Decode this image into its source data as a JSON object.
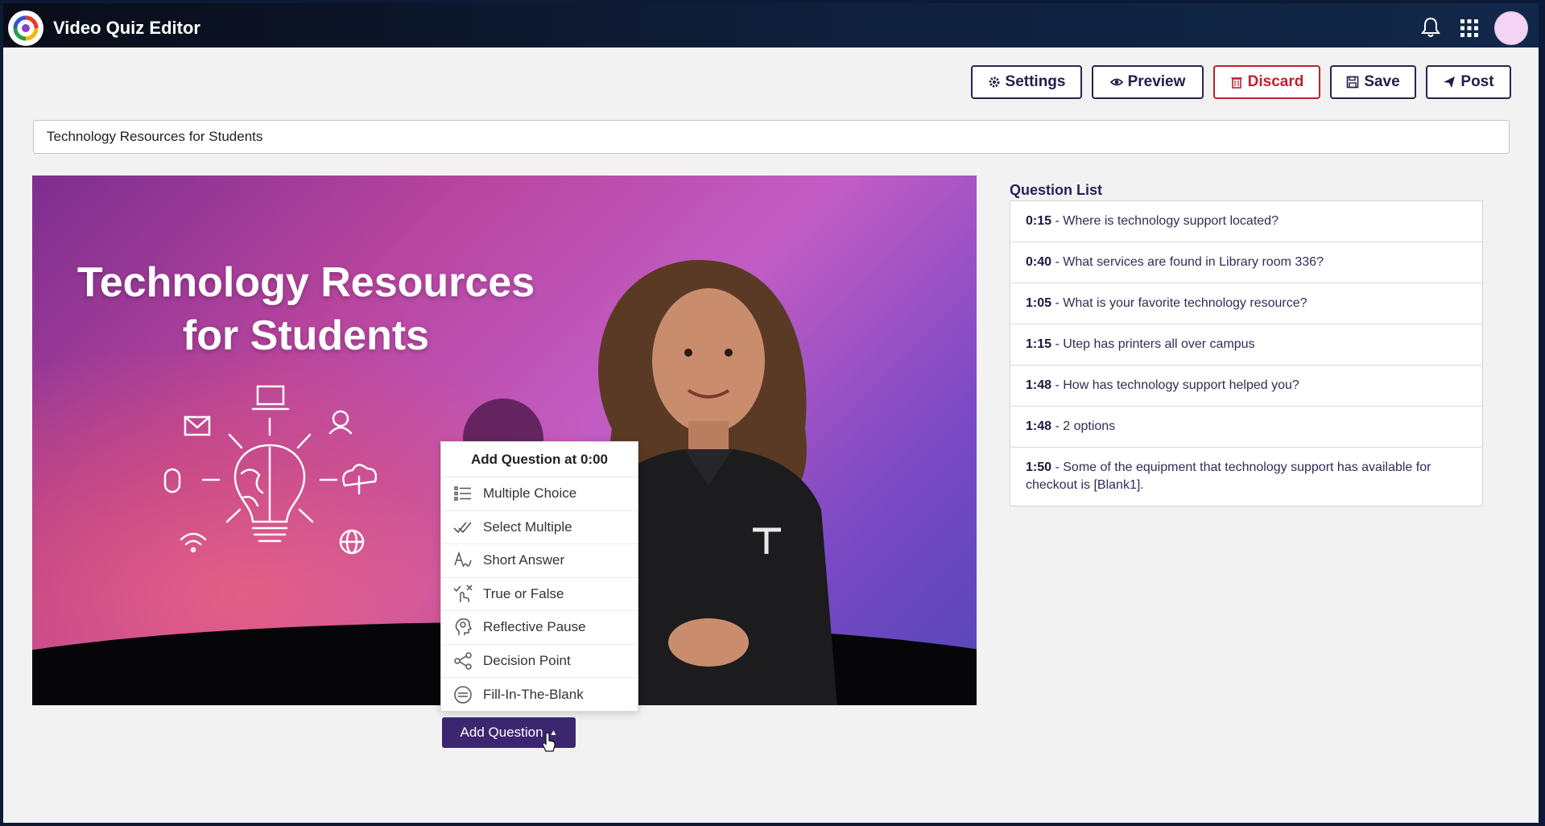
{
  "app": {
    "title": "Video Quiz Editor",
    "icons": [
      "logo-icon",
      "bell-icon",
      "grid-icon",
      "avatar"
    ]
  },
  "toolbar": {
    "settings_label": "Settings",
    "preview_label": "Preview",
    "discard_label": "Discard",
    "save_label": "Save",
    "post_label": "Post"
  },
  "quiz": {
    "title_value": "Technology Resources for Students"
  },
  "video": {
    "title_line1": "Technology Resources",
    "title_line2": "for Students"
  },
  "add_menu": {
    "header": "Add Question at 0:00",
    "items": [
      {
        "label": "Multiple Choice",
        "icon": "list-icon"
      },
      {
        "label": "Select Multiple",
        "icon": "double-check-icon"
      },
      {
        "label": "Short Answer",
        "icon": "text-answer-icon"
      },
      {
        "label": "True or False",
        "icon": "true-false-icon"
      },
      {
        "label": "Reflective Pause",
        "icon": "head-icon"
      },
      {
        "label": "Decision Point",
        "icon": "share-nodes-icon"
      },
      {
        "label": "Fill-In-The-Blank",
        "icon": "blank-circle-icon"
      }
    ],
    "button_label": "Add Question"
  },
  "question_list": {
    "title": "Question List",
    "items": [
      {
        "time": "0:15",
        "text": " - Where is technology support located?"
      },
      {
        "time": "0:40",
        "text": " - What services are found in Library room 336?"
      },
      {
        "time": "1:05",
        "text": " - What is your favorite technology resource?"
      },
      {
        "time": "1:15",
        "text": " - Utep has printers all over campus"
      },
      {
        "time": "1:48",
        "text": " - How has technology support helped you?"
      },
      {
        "time": "1:48",
        "text": " - 2 options"
      },
      {
        "time": "1:50",
        "text": " - Some of the equipment that technology support has available for checkout is [Blank1]."
      }
    ]
  },
  "colors": {
    "accent": "#3b2770",
    "discard": "#c01f2e",
    "topbar": "#0f1f3d"
  }
}
